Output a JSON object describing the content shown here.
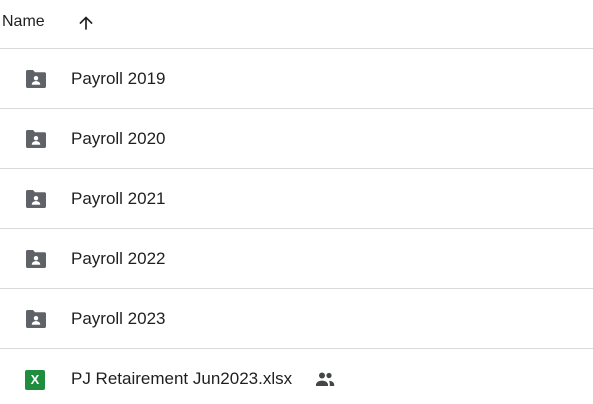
{
  "header": {
    "column_label": "Name",
    "sort_icon": "arrow-up-icon"
  },
  "rows": [
    {
      "name": "Payroll 2019",
      "icon": "shared-folder-icon"
    },
    {
      "name": "Payroll 2020",
      "icon": "shared-folder-icon"
    },
    {
      "name": "Payroll 2021",
      "icon": "shared-folder-icon"
    },
    {
      "name": "Payroll 2022",
      "icon": "shared-folder-icon"
    },
    {
      "name": "Payroll 2023",
      "icon": "shared-folder-icon"
    },
    {
      "name": "PJ Retairement Jun2023.xlsx",
      "icon": "excel-file-icon",
      "file_icon_letter": "X",
      "shared_icon": "people-icon"
    }
  ],
  "colors": {
    "folder_icon": "#5f6368",
    "excel_icon": "#1e8e3e",
    "divider": "#d9d9d9",
    "text": "#1f1f1f"
  }
}
